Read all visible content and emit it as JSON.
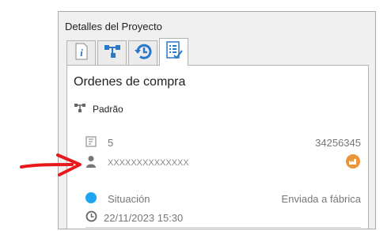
{
  "panel": {
    "title": "Detalles del Proyecto",
    "tabs": [
      {
        "icon": "info-icon",
        "active": false
      },
      {
        "icon": "hierarchy-icon",
        "active": false
      },
      {
        "icon": "history-icon",
        "active": false
      },
      {
        "icon": "checklist-icon",
        "active": true
      }
    ]
  },
  "order": {
    "heading": "Ordenes de compra",
    "type_label": "Padrão",
    "count": "5",
    "number": "34256345",
    "supplier": "XXXXXXXXXXXXXX",
    "status_label": "Situación",
    "status_value": "Enviada a fábrica",
    "status_color": "#1ea7f0",
    "date": "22/11/2023 15:30"
  },
  "colors": {
    "accent": "#2a78c8",
    "annotation_arrow": "#e8191c",
    "factory_badge": "#e9963a"
  }
}
